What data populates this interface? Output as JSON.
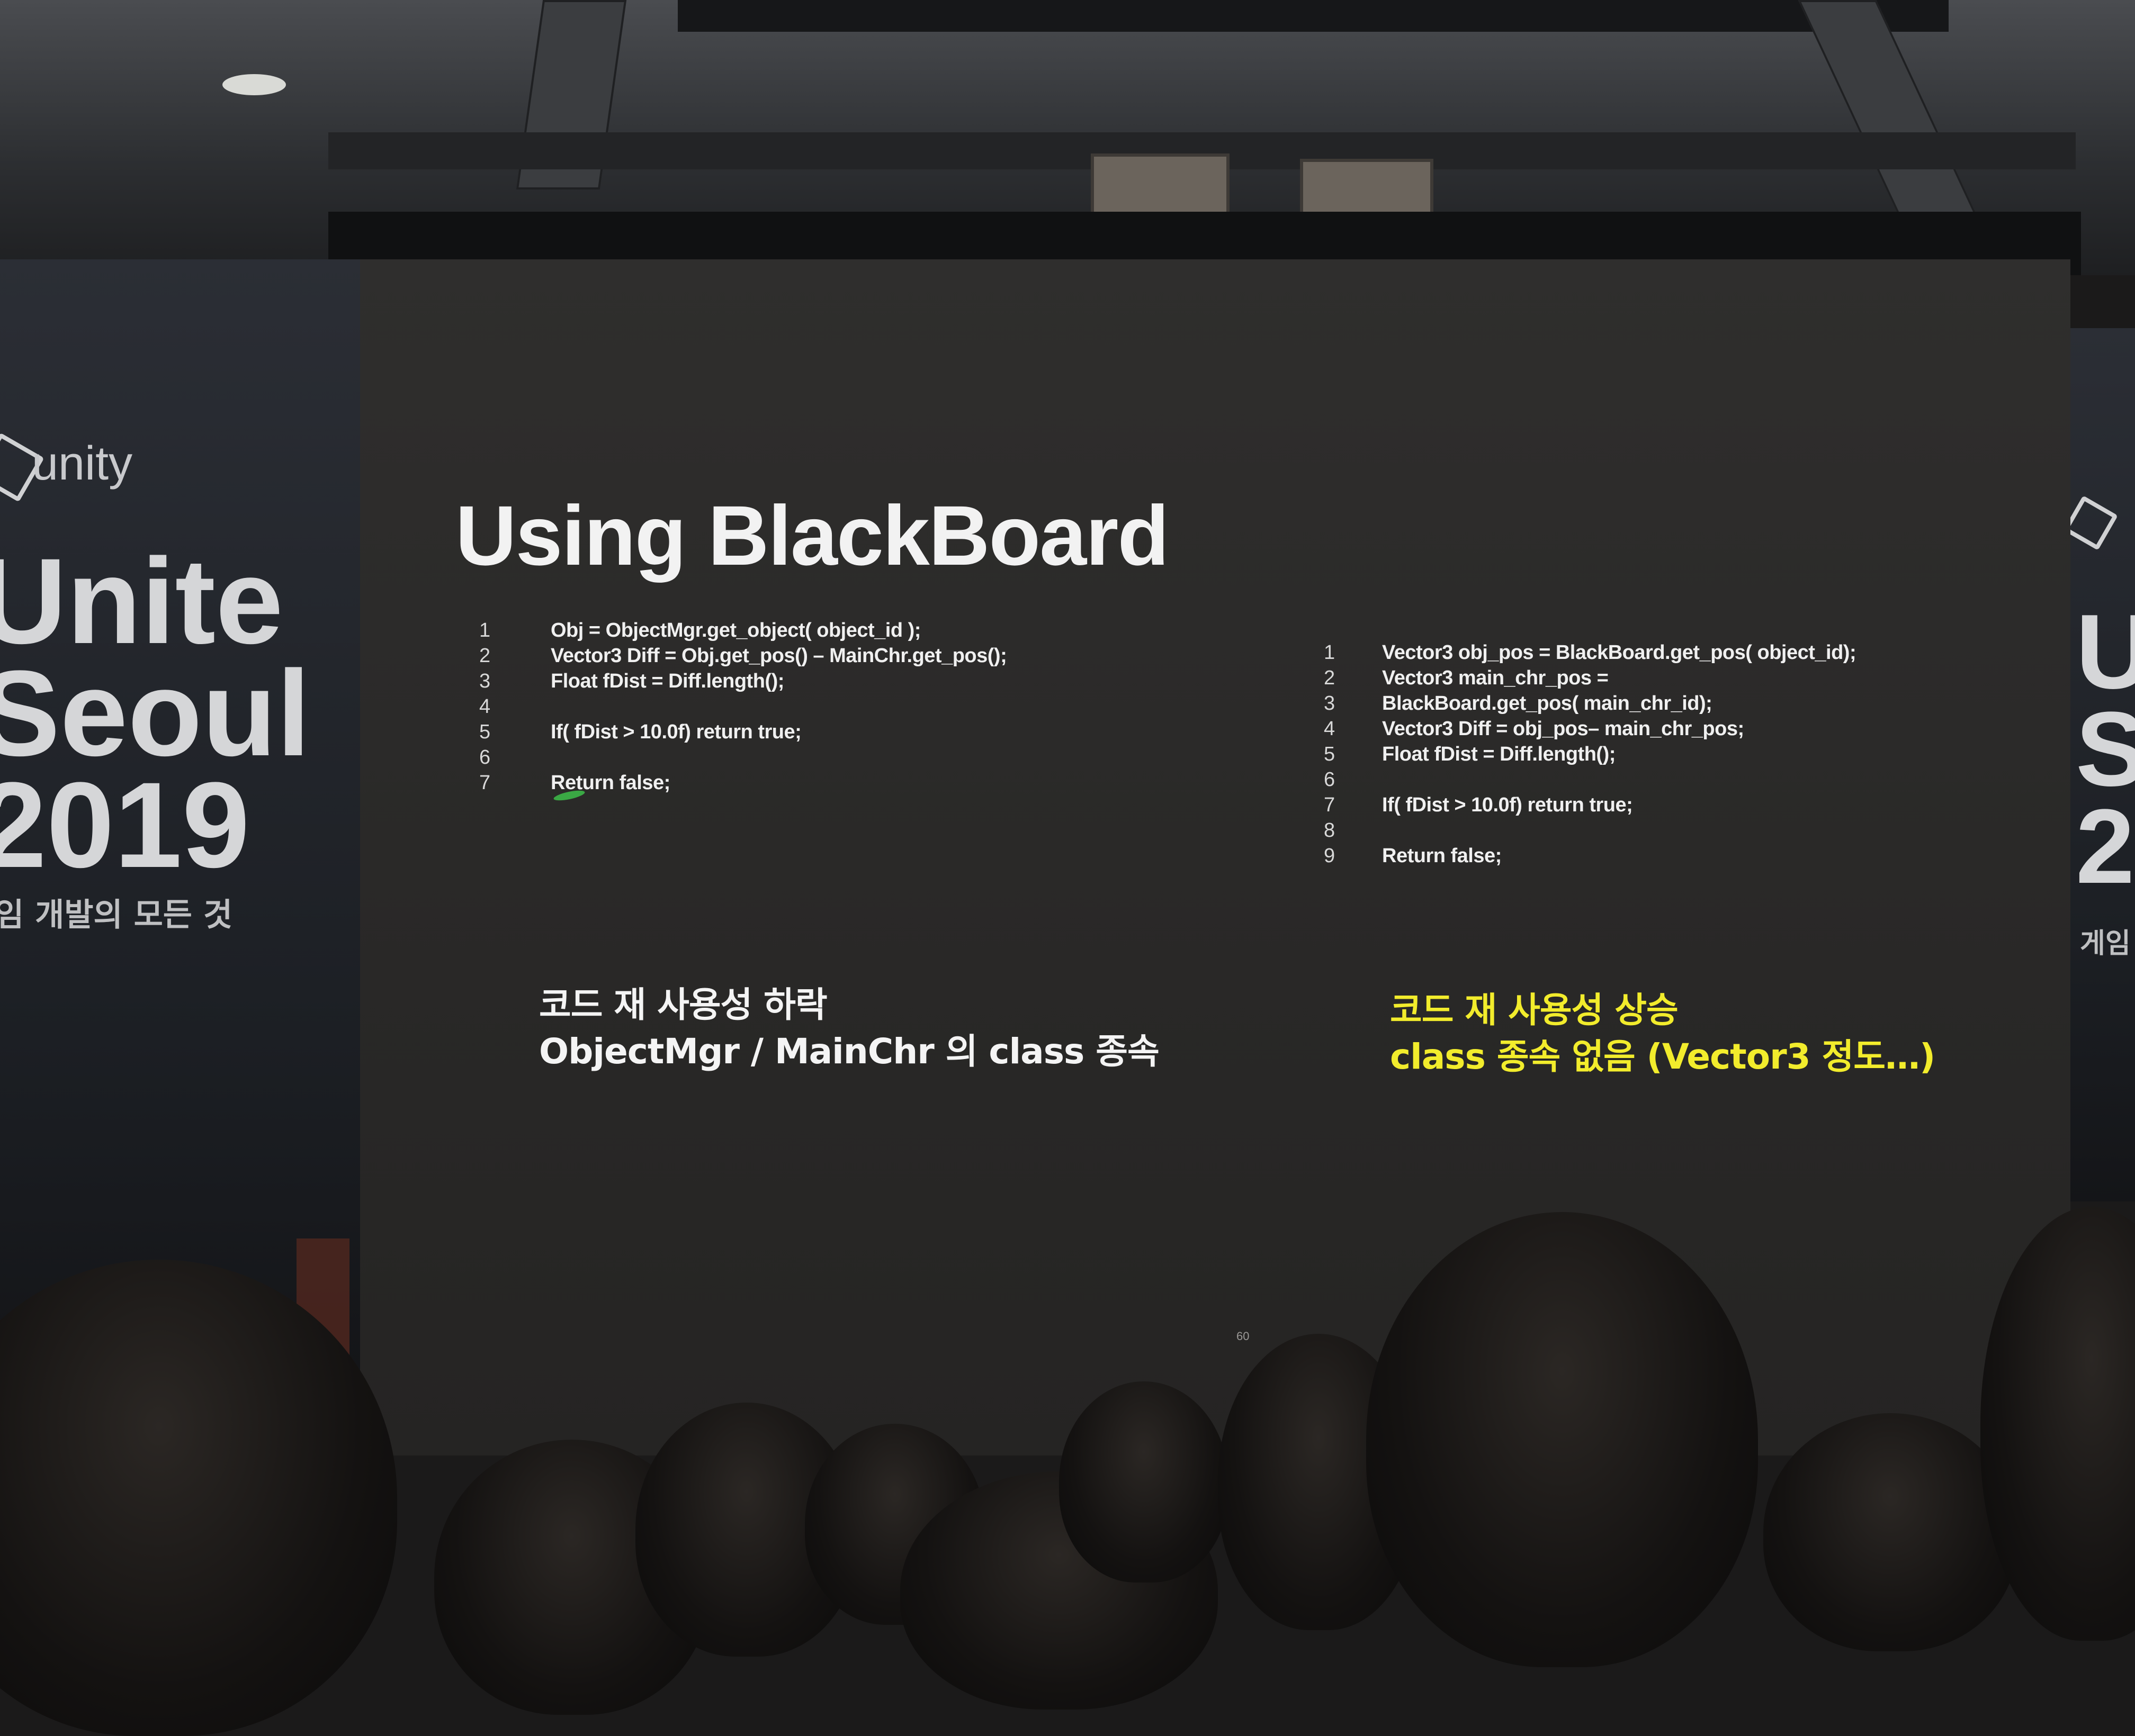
{
  "left_banner": {
    "logo_text": "unity",
    "title_lines": [
      "Unite",
      "Seoul",
      "2019"
    ],
    "tagline": "임 개발의 모든 것"
  },
  "right_banner": {
    "title_lines": [
      "U",
      "S",
      "2"
    ],
    "tagline": "게임"
  },
  "slide": {
    "title": "Using BlackBoard",
    "left_code": [
      {
        "num": "1",
        "code": "Obj = ObjectMgr.get_object( object_id );"
      },
      {
        "num": "2",
        "code": "Vector3 Diff = Obj.get_pos() – MainChr.get_pos();"
      },
      {
        "num": "3",
        "code": "Float fDist = Diff.length();"
      },
      {
        "num": "4",
        "code": ""
      },
      {
        "num": "5",
        "code": "If( fDist > 10.0f) return true;"
      },
      {
        "num": "6",
        "code": ""
      },
      {
        "num": "7",
        "code": "Return false;"
      }
    ],
    "right_code": [
      {
        "num": "1",
        "code": "Vector3 obj_pos = BlackBoard.get_pos( object_id);"
      },
      {
        "num": "2",
        "code": "Vector3 main_chr_pos ="
      },
      {
        "num": "3",
        "code": "BlackBoard.get_pos( main_chr_id);"
      },
      {
        "num": "4",
        "code": "Vector3 Diff = obj_pos– main_chr_pos;"
      },
      {
        "num": "5",
        "code": "Float fDist = Diff.length();"
      },
      {
        "num": "6",
        "code": ""
      },
      {
        "num": "7",
        "code": "If( fDist > 10.0f) return true;"
      },
      {
        "num": "8",
        "code": ""
      },
      {
        "num": "9",
        "code": "Return false;"
      }
    ],
    "left_caption": [
      "코드 재 사용성 하락",
      "ObjectMgr / MainChr  의 class 종속"
    ],
    "right_caption": [
      "코드 재 사용성 상승",
      "class 종속 없음 (Vector3 정도…)"
    ],
    "page_number": "60",
    "colors": {
      "left_caption": "#f4f4f4",
      "right_caption": "#f2ec2c",
      "background": "#2b2a29"
    }
  }
}
